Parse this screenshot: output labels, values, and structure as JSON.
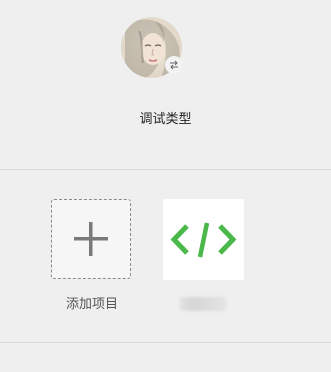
{
  "header": {
    "avatar_icon": "portrait-avatar-icon",
    "switch_icon": "swap-arrows-icon",
    "title": "调试类型"
  },
  "cards": {
    "add": {
      "icon": "plus-icon",
      "label": "添加项目"
    },
    "code": {
      "icon": "code-brackets-icon",
      "icon_color": "#4ab84a"
    }
  },
  "colors": {
    "background": "#efefef",
    "divider": "#d9d9d9",
    "plus": "#7a7a7a",
    "code_green": "#4ab84a"
  }
}
